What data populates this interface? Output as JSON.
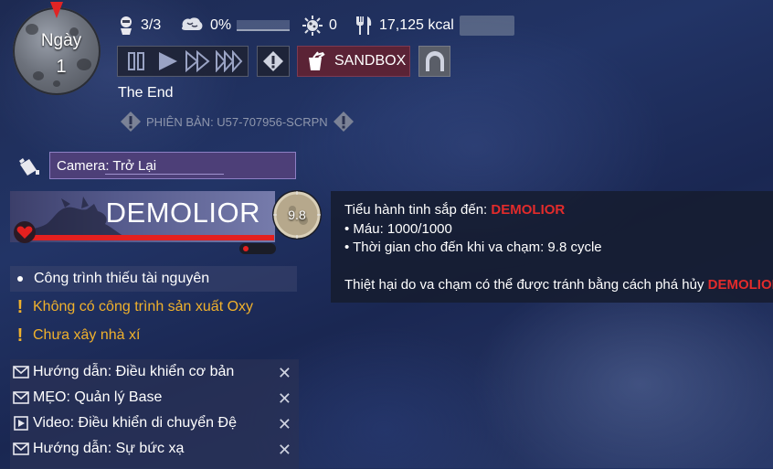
{
  "day": {
    "label": "Ngày",
    "number": "1"
  },
  "stats": {
    "duplicants": "3/3",
    "stress": "0%",
    "sick": "0",
    "calories": "17,125 kcal"
  },
  "controls": {
    "sandbox_label": "SANDBOX"
  },
  "colony_name": "The End",
  "version": "PHIÊN BẢN: U57-707956-SCRPN",
  "camera": {
    "label": "Camera: Trở Lại"
  },
  "demolior": {
    "name": "DEMOLIOR",
    "timer": "9.8",
    "health_fraction": 1.0
  },
  "tooltip": {
    "line1_prefix": "Tiểu hành tinh sắp đến: ",
    "line1_name": "DEMOLIOR",
    "line2": "• Máu: 1000/1000",
    "line3": "• Thời gian cho đến khi va chạm: 9.8 cycle",
    "line4_prefix": "Thiệt hại do va chạm có thể được tránh bằng cách phá hủy ",
    "line4_name": "DEMOLIOR"
  },
  "alerts": [
    {
      "text": "Công trình thiếu tài nguyên"
    },
    {
      "text": "Không có công trình sản xuất Oxy"
    },
    {
      "text": "Chưa xây nhà xí"
    }
  ],
  "messages": [
    {
      "text": "Hướng dẫn: Điều khiển cơ bản",
      "icon": "envelope-icon"
    },
    {
      "text": "MẸO: Quản lý Base",
      "icon": "envelope-icon"
    },
    {
      "text": "Video: Điều khiển di chuyển Đệ",
      "icon": "video-icon"
    },
    {
      "text": "Hướng dẫn: Sự bức xạ",
      "icon": "envelope-icon"
    }
  ],
  "colors": {
    "danger": "#e22b2b",
    "warning": "#f0b12c",
    "sandbox": "#5b2336",
    "camera": "#4d3f78"
  }
}
